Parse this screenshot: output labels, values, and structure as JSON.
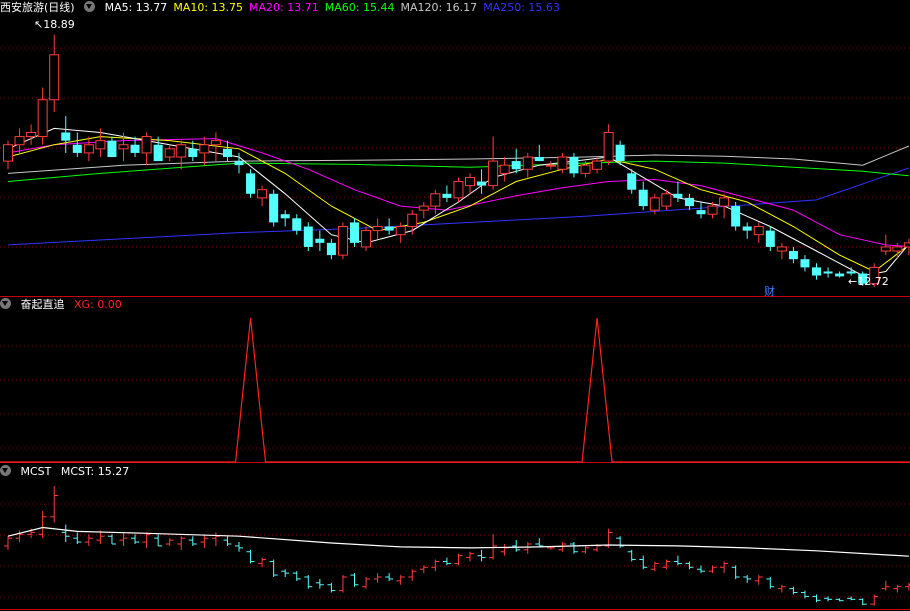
{
  "colors": {
    "up": "#ff3c3c",
    "down": "#54ffff",
    "ma5": "#ffffff",
    "ma10": "#ffff00",
    "ma20": "#ff00ff",
    "ma60": "#00ff00",
    "ma120": "#c8c8c8",
    "ma250": "#3232ff",
    "grid": "#8a0000",
    "divider": "#c8000f",
    "xg": "#ff2020",
    "mcst": "#ffffff",
    "fin": "#4080ff"
  },
  "main_panel": {
    "stock_name": "西安旅游(日线)",
    "indicators": [
      {
        "label": "MA5: 13.77",
        "color": "#ffffff"
      },
      {
        "label": "MA10: 13.75",
        "color": "#ffff00"
      },
      {
        "label": "MA20: 13.71",
        "color": "#ff00ff"
      },
      {
        "label": "MA60: 15.44",
        "color": "#00ff00"
      },
      {
        "label": "MA120: 16.17",
        "color": "#c8c8c8"
      },
      {
        "label": "MA250: 15.63",
        "color": "#3232ff"
      }
    ],
    "high_label": "18.89",
    "low_label": "12.72",
    "fin_marker": "财"
  },
  "panel2": {
    "title": "奋起直追",
    "value_label": "XG: 0.00"
  },
  "panel3": {
    "title": "MCST",
    "value_label": "MCST: 15.27"
  },
  "chart_data": [
    {
      "type": "candlestick",
      "title": "西安旅游(日线)",
      "ylim": [
        12.5,
        19.3
      ],
      "candles": [
        [
          15.8,
          16.3,
          15.6,
          16.2
        ],
        [
          16.2,
          16.6,
          16.0,
          16.4
        ],
        [
          16.4,
          16.7,
          16.2,
          16.5
        ],
        [
          16.4,
          17.6,
          16.2,
          17.3
        ],
        [
          17.3,
          18.89,
          17.0,
          18.4
        ],
        [
          16.5,
          16.9,
          16.0,
          16.3
        ],
        [
          16.2,
          16.5,
          15.9,
          16.0
        ],
        [
          16.0,
          16.4,
          15.8,
          16.2
        ],
        [
          16.1,
          16.6,
          15.9,
          16.3
        ],
        [
          16.3,
          16.4,
          15.9,
          15.9
        ],
        [
          16.1,
          16.5,
          15.8,
          16.2
        ],
        [
          16.2,
          16.4,
          15.9,
          16.0
        ],
        [
          16.0,
          16.5,
          15.7,
          16.4
        ],
        [
          16.2,
          16.4,
          15.8,
          15.8
        ],
        [
          15.9,
          16.2,
          15.8,
          16.1
        ],
        [
          15.9,
          16.3,
          15.6,
          16.2
        ],
        [
          16.1,
          16.3,
          15.8,
          15.9
        ],
        [
          16.0,
          16.4,
          15.7,
          16.2
        ],
        [
          16.2,
          16.5,
          15.8,
          16.3
        ],
        [
          16.1,
          16.3,
          15.8,
          15.9
        ],
        [
          15.8,
          16.0,
          15.5,
          15.7
        ],
        [
          15.5,
          15.6,
          14.9,
          15.0
        ],
        [
          14.9,
          15.2,
          14.7,
          15.1
        ],
        [
          15.0,
          15.1,
          14.2,
          14.3
        ],
        [
          14.5,
          14.6,
          14.2,
          14.4
        ],
        [
          14.4,
          14.5,
          14.0,
          14.1
        ],
        [
          14.2,
          14.3,
          13.6,
          13.7
        ],
        [
          13.9,
          14.1,
          13.6,
          13.8
        ],
        [
          13.8,
          13.9,
          13.4,
          13.5
        ],
        [
          13.5,
          14.3,
          13.4,
          14.2
        ],
        [
          14.3,
          14.4,
          13.7,
          13.8
        ],
        [
          13.7,
          14.2,
          13.6,
          14.1
        ],
        [
          14.1,
          14.4,
          13.9,
          14.2
        ],
        [
          14.2,
          14.4,
          14.0,
          14.1
        ],
        [
          14.0,
          14.3,
          13.8,
          14.2
        ],
        [
          14.2,
          14.6,
          14.0,
          14.5
        ],
        [
          14.6,
          14.8,
          14.4,
          14.7
        ],
        [
          14.7,
          15.1,
          14.5,
          15.0
        ],
        [
          15.0,
          15.2,
          14.8,
          14.9
        ],
        [
          14.9,
          15.4,
          14.8,
          15.3
        ],
        [
          15.2,
          15.5,
          15.0,
          15.4
        ],
        [
          15.3,
          15.6,
          15.0,
          15.2
        ],
        [
          15.2,
          16.4,
          15.1,
          15.8
        ],
        [
          15.5,
          15.9,
          15.3,
          15.7
        ],
        [
          15.8,
          16.1,
          15.5,
          15.6
        ],
        [
          15.6,
          16.0,
          15.4,
          15.9
        ],
        [
          15.9,
          16.2,
          15.8,
          15.8
        ],
        [
          15.7,
          15.8,
          15.6,
          15.7
        ],
        [
          15.6,
          16.0,
          15.5,
          15.9
        ],
        [
          15.9,
          16.0,
          15.4,
          15.5
        ],
        [
          15.5,
          15.8,
          15.4,
          15.7
        ],
        [
          15.6,
          15.9,
          15.5,
          15.8
        ],
        [
          15.8,
          16.7,
          15.7,
          16.5
        ],
        [
          16.2,
          16.3,
          15.7,
          15.8
        ],
        [
          15.5,
          15.6,
          15.0,
          15.1
        ],
        [
          15.1,
          15.3,
          14.6,
          14.7
        ],
        [
          14.6,
          15.0,
          14.5,
          14.9
        ],
        [
          14.7,
          15.1,
          14.6,
          15.0
        ],
        [
          15.0,
          15.3,
          14.8,
          14.9
        ],
        [
          14.9,
          15.0,
          14.6,
          14.7
        ],
        [
          14.6,
          14.8,
          14.4,
          14.5
        ],
        [
          14.5,
          14.8,
          14.4,
          14.7
        ],
        [
          14.7,
          15.0,
          14.4,
          14.9
        ],
        [
          14.7,
          14.8,
          14.1,
          14.2
        ],
        [
          14.2,
          14.3,
          13.9,
          14.1
        ],
        [
          14.0,
          14.3,
          13.8,
          14.2
        ],
        [
          14.1,
          14.2,
          13.6,
          13.7
        ],
        [
          13.6,
          13.8,
          13.4,
          13.7
        ],
        [
          13.6,
          13.7,
          13.3,
          13.4
        ],
        [
          13.4,
          13.5,
          13.1,
          13.2
        ],
        [
          13.2,
          13.3,
          12.9,
          13.0
        ],
        [
          13.1,
          13.2,
          12.95,
          13.05
        ],
        [
          13.05,
          13.1,
          12.95,
          12.98
        ],
        [
          13.1,
          13.2,
          13.0,
          13.05
        ],
        [
          13.05,
          13.1,
          12.75,
          12.8
        ],
        [
          12.8,
          13.3,
          12.72,
          13.2
        ],
        [
          13.6,
          14.0,
          13.5,
          13.7
        ],
        [
          13.6,
          13.8,
          13.4,
          13.7
        ],
        [
          13.7,
          13.9,
          13.5,
          13.8
        ]
      ],
      "ma5": [
        [
          0,
          16.1
        ],
        [
          4,
          16.6
        ],
        [
          8,
          16.5
        ],
        [
          14,
          16.2
        ],
        [
          20,
          15.9
        ],
        [
          24,
          15.0
        ],
        [
          28,
          14.0
        ],
        [
          31,
          13.8
        ],
        [
          35,
          14.1
        ],
        [
          39,
          14.8
        ],
        [
          42,
          15.4
        ],
        [
          46,
          15.7
        ],
        [
          52,
          15.9
        ],
        [
          55,
          15.4
        ],
        [
          58,
          14.9
        ],
        [
          62,
          14.7
        ],
        [
          66,
          14.2
        ],
        [
          70,
          13.6
        ],
        [
          74,
          13.0
        ],
        [
          76,
          13.1
        ],
        [
          78,
          13.77
        ]
      ],
      "ma10": [
        [
          0,
          15.9
        ],
        [
          4,
          16.2
        ],
        [
          8,
          16.4
        ],
        [
          14,
          16.3
        ],
        [
          20,
          16.1
        ],
        [
          24,
          15.5
        ],
        [
          28,
          14.7
        ],
        [
          32,
          14.1
        ],
        [
          36,
          14.3
        ],
        [
          40,
          14.7
        ],
        [
          44,
          15.3
        ],
        [
          48,
          15.6
        ],
        [
          52,
          15.85
        ],
        [
          56,
          15.6
        ],
        [
          60,
          15.1
        ],
        [
          64,
          14.8
        ],
        [
          68,
          14.2
        ],
        [
          72,
          13.5
        ],
        [
          75,
          13.1
        ],
        [
          78,
          13.75
        ]
      ],
      "ma20": [
        [
          0,
          16.0
        ],
        [
          4,
          16.2
        ],
        [
          10,
          16.3
        ],
        [
          18,
          16.35
        ],
        [
          22,
          16.0
        ],
        [
          26,
          15.6
        ],
        [
          30,
          15.1
        ],
        [
          34,
          14.7
        ],
        [
          38,
          14.6
        ],
        [
          44,
          14.95
        ],
        [
          48,
          15.15
        ],
        [
          52,
          15.3
        ],
        [
          56,
          15.35
        ],
        [
          60,
          15.2
        ],
        [
          64,
          14.9
        ],
        [
          68,
          14.6
        ],
        [
          72,
          14.0
        ],
        [
          76,
          13.75
        ],
        [
          78,
          13.71
        ]
      ],
      "ma60": [
        [
          0,
          15.3
        ],
        [
          8,
          15.5
        ],
        [
          20,
          15.75
        ],
        [
          30,
          15.72
        ],
        [
          40,
          15.65
        ],
        [
          50,
          15.75
        ],
        [
          56,
          15.8
        ],
        [
          62,
          15.75
        ],
        [
          68,
          15.65
        ],
        [
          74,
          15.55
        ],
        [
          78,
          15.44
        ]
      ],
      "ma120": [
        [
          0,
          15.5
        ],
        [
          10,
          15.7
        ],
        [
          20,
          15.8
        ],
        [
          30,
          15.82
        ],
        [
          40,
          15.85
        ],
        [
          50,
          15.9
        ],
        [
          56,
          15.95
        ],
        [
          62,
          15.92
        ],
        [
          68,
          15.85
        ],
        [
          74,
          15.7
        ],
        [
          78,
          16.17
        ]
      ],
      "ma250": [
        [
          0,
          13.75
        ],
        [
          10,
          13.9
        ],
        [
          20,
          14.05
        ],
        [
          30,
          14.15
        ],
        [
          40,
          14.3
        ],
        [
          50,
          14.45
        ],
        [
          60,
          14.65
        ],
        [
          70,
          14.85
        ],
        [
          78,
          15.63
        ]
      ]
    },
    {
      "type": "line",
      "title": "奋起直追",
      "series": [
        {
          "name": "XG",
          "spikes_at": [
            21,
            51
          ],
          "values_note": "0 elsewhere, 1 at spike"
        }
      ],
      "ylim": [
        0,
        1
      ]
    },
    {
      "type": "line",
      "title": "MCST",
      "ylim": [
        12.5,
        19.3
      ],
      "mcst": [
        [
          0,
          16.3
        ],
        [
          3,
          16.75
        ],
        [
          6,
          16.55
        ],
        [
          12,
          16.45
        ],
        [
          20,
          16.3
        ],
        [
          28,
          15.95
        ],
        [
          34,
          15.75
        ],
        [
          40,
          15.7
        ],
        [
          46,
          15.75
        ],
        [
          52,
          15.85
        ],
        [
          58,
          15.8
        ],
        [
          64,
          15.7
        ],
        [
          70,
          15.55
        ],
        [
          78,
          15.27
        ]
      ]
    }
  ]
}
